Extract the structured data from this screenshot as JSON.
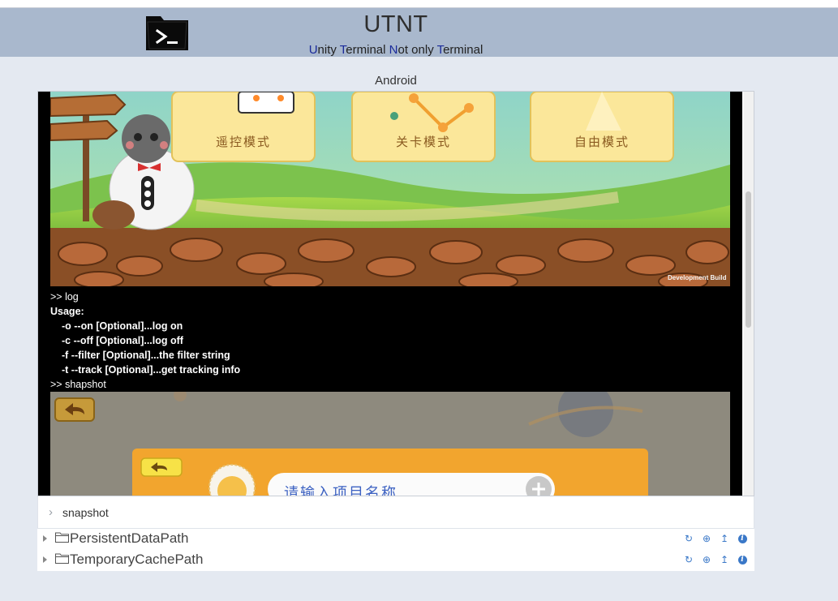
{
  "header": {
    "title": "UTNT",
    "subtitle_parts": [
      {
        "text": "U",
        "hl": true
      },
      {
        "text": "nity ",
        "hl": false
      },
      {
        "text": "T",
        "hl": true
      },
      {
        "text": "erminal ",
        "hl": false
      },
      {
        "text": "N",
        "hl": true
      },
      {
        "text": "ot only ",
        "hl": false
      },
      {
        "text": "T",
        "hl": true
      },
      {
        "text": "erminal",
        "hl": false
      }
    ],
    "logo_icon": "terminal-folder-icon"
  },
  "panel": {
    "label": "Android"
  },
  "terminal": {
    "game_top": {
      "mode_buttons": [
        "遥控模式",
        "关卡模式",
        "自由模式"
      ],
      "watermark": "Development Build"
    },
    "lines": [
      {
        "text": ">> log",
        "style": "cmd"
      },
      {
        "text": "Usage:",
        "style": "bold"
      },
      {
        "text": "-o --on [Optional]...log on",
        "style": "bold indent"
      },
      {
        "text": "-c --off [Optional]...log off",
        "style": "bold indent"
      },
      {
        "text": "-f  --filter [Optional]...the filter string",
        "style": "bold indent"
      },
      {
        "text": "-t  --track [Optional]...get tracking info",
        "style": "bold indent"
      },
      {
        "text": ">> shapshot",
        "style": "cmd"
      }
    ],
    "game_bottom": {
      "input_placeholder": "请输入项目名称"
    }
  },
  "command_input": {
    "value": "snapshot",
    "prompt_glyph": "›"
  },
  "tree": {
    "rows": [
      {
        "label": "PersistentDataPath"
      },
      {
        "label": "TemporaryCachePath"
      }
    ],
    "row_actions": [
      "refresh-icon",
      "add-icon",
      "upload-icon",
      "info-icon"
    ]
  },
  "colors": {
    "header_bg": "#a9b8cd",
    "page_bg": "#e4e9f1",
    "highlight_letter": "#1a2a9a",
    "action_icon": "#3a78c8"
  }
}
